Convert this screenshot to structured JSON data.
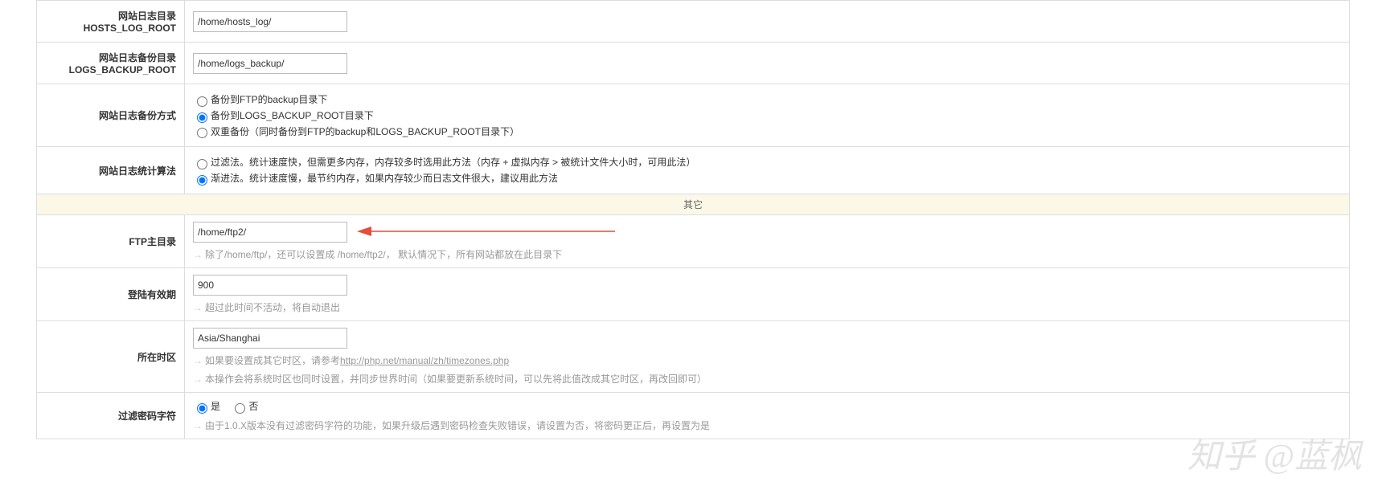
{
  "rows": {
    "hosts_log_root": {
      "label_cn": "网站日志目录",
      "label_en": "HOSTS_LOG_ROOT",
      "value": "/home/hosts_log/"
    },
    "logs_backup_root": {
      "label_cn": "网站日志备份目录",
      "label_en": "LOGS_BACKUP_ROOT",
      "value": "/home/logs_backup/"
    },
    "backup_method": {
      "label": "网站日志备份方式",
      "options": [
        {
          "text": "备份到FTP的backup目录下",
          "checked": false
        },
        {
          "text": "备份到LOGS_BACKUP_ROOT目录下",
          "checked": true
        },
        {
          "text": "双重备份（同时备份到FTP的backup和LOGS_BACKUP_ROOT目录下）",
          "checked": false
        }
      ]
    },
    "stats_method": {
      "label": "网站日志统计算法",
      "options": [
        {
          "text": "过滤法。统计速度快，但需更多内存，内存较多时选用此方法（内存 + 虚拟内存 > 被统计文件大小时，可用此法）",
          "checked": false
        },
        {
          "text": "渐进法。统计速度慢，最节约内存，如果内存较少而日志文件很大，建议用此方法",
          "checked": true
        }
      ]
    },
    "section_other": "其它",
    "ftp_root": {
      "label": "FTP主目录",
      "value": "/home/ftp2/",
      "hint": "除了/home/ftp/，还可以设置成 /home/ftp2/， 默认情况下，所有网站都放在此目录下"
    },
    "login_expire": {
      "label": "登陆有效期",
      "value": "900",
      "hint": "超过此时间不活动，将自动退出"
    },
    "timezone": {
      "label": "所在时区",
      "value": "Asia/Shanghai",
      "hint1_pre": "如果要设置成其它时区，请参考",
      "hint1_link": "http://php.net/manual/zh/timezones.php",
      "hint2": "本操作会将系统时区也同时设置，并同步世界时间（如果要更新系统时间，可以先将此值改成其它时区，再改回即可）"
    },
    "pwd_filter": {
      "label": "过滤密码字符",
      "options": [
        {
          "text": "是",
          "checked": true
        },
        {
          "text": "否",
          "checked": false
        }
      ],
      "hint": "由于1.0.X版本没有过滤密码字符的功能，如果升级后遇到密码检查失败错误，请设置为否，将密码更正后，再设置为是"
    }
  },
  "watermark": "知乎 @蓝枫"
}
